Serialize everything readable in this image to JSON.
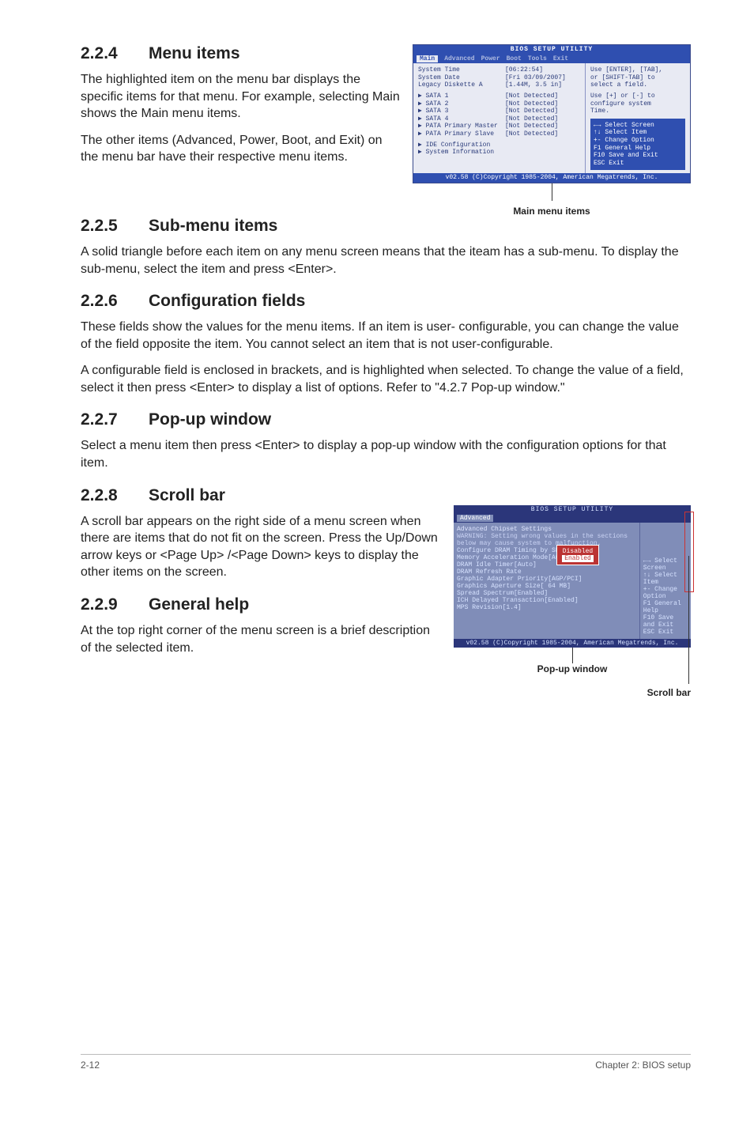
{
  "sections": {
    "s224": {
      "num": "2.2.4",
      "title": "Menu items"
    },
    "s225": {
      "num": "2.2.5",
      "title": "Sub-menu items"
    },
    "s226": {
      "num": "2.2.6",
      "title": "Configuration fields"
    },
    "s227": {
      "num": "2.2.7",
      "title": "Pop-up window"
    },
    "s228": {
      "num": "2.2.8",
      "title": "Scroll bar"
    },
    "s229": {
      "num": "2.2.9",
      "title": "General help"
    }
  },
  "para": {
    "p224a": "The highlighted item on the menu bar displays the specific items for that menu. For example, selecting Main shows the Main menu items.",
    "p224b": "The other items (Advanced, Power, Boot, and Exit) on the menu bar have their respective menu items.",
    "p225": "A solid triangle before each item on any menu screen means that the iteam has a sub-menu. To display the sub-menu, select the item and press <Enter>.",
    "p226a": "These fields show the values for the menu items. If an item is user- configurable, you can change the value of the field opposite the item. You cannot select an item that is not user-configurable.",
    "p226b": "A configurable field is enclosed in brackets, and is highlighted when selected. To change the value of a field, select it then press <Enter> to display a list of options. Refer to \"4.2.7 Pop-up window.\"",
    "p227": "Select a menu item then press <Enter> to display a pop-up window with the configuration options for that item.",
    "p228": "A scroll bar appears on the right side of a menu screen when there are items that do not fit on the screen. Press the Up/Down arrow keys or <Page Up> /<Page Down> keys to display the other items on the screen.",
    "p229": "At the top right corner of the menu screen is a brief description of the selected item."
  },
  "fig1": {
    "caption": "Main menu items",
    "titlebar": "BIOS SETUP UTILITY",
    "tabs": {
      "main": "Main",
      "advanced": "Advanced",
      "power": "Power",
      "boot": "Boot",
      "tools": "Tools",
      "exit": "Exit"
    },
    "rows": {
      "time": {
        "k": "System Time",
        "v": "[06:22:54]"
      },
      "date": {
        "k": "System Date",
        "v": "[Fri 03/09/2007]"
      },
      "floppy": {
        "k": "Legacy Diskette A",
        "v": "[1.44M, 3.5 in]"
      },
      "sata1": {
        "k": "SATA 1",
        "v": "[Not Detected]"
      },
      "sata2": {
        "k": "SATA 2",
        "v": "[Not Detected]"
      },
      "sata3": {
        "k": "SATA 3",
        "v": "[Not Detected]"
      },
      "sata4": {
        "k": "SATA 4",
        "v": "[Not Detected]"
      },
      "patam": {
        "k": "PATA Primary Master",
        "v": "[Not Detected]"
      },
      "patas": {
        "k": "PATA Primary Slave",
        "v": "[Not Detected]"
      },
      "ide": {
        "k": "IDE Configuration",
        "v": ""
      },
      "sysinfo": {
        "k": "System Information",
        "v": ""
      }
    },
    "help": {
      "l1": "Use [ENTER], [TAB],",
      "l2": "or [SHIFT-TAB] to",
      "l3": "select a field.",
      "l4": "Use [+] or [-] to",
      "l5": "configure system",
      "l6": "Time.",
      "k1": "←→    Select Screen",
      "k2": "↑↓    Select Item",
      "k3": "+-    Change Option",
      "k4": "F1    General Help",
      "k5": "F10   Save and Exit",
      "k6": "ESC   Exit"
    },
    "foot": "v02.58 (C)Copyright 1985-2004, American Megatrends, Inc."
  },
  "fig2": {
    "caption_popup": "Pop-up window",
    "caption_scroll": "Scroll bar",
    "titlebar": "BIOS SETUP UTILITY",
    "tab": "Advanced",
    "header": "Advanced Chipset Settings",
    "warn": "WARNING: Setting wrong values in the sections below may cause system to malfunction.",
    "rows": {
      "r1": {
        "k": "Configure DRAM Timing by SPD",
        "v": "[Enabled]"
      },
      "r2": {
        "k": "Memory Acceleration Mode",
        "v": "[Auto]"
      },
      "r3": {
        "k": "DRAM Idle Timer",
        "v": "[Auto]"
      },
      "r4": {
        "k": "DRAM Refresh Rate",
        "v": ""
      },
      "r5": {
        "k": "Graphic Adapter Priority",
        "v": "[AGP/PCI]"
      },
      "r6": {
        "k": "Graphics Aperture Size",
        "v": "[ 64 MB]"
      },
      "r7": {
        "k": "Spread Spectrum",
        "v": "[Enabled]"
      },
      "r8": {
        "k": "ICH Delayed Transaction",
        "v": "[Enabled]"
      },
      "r9": {
        "k": "MPS Revision",
        "v": "[1.4]"
      }
    },
    "popup": {
      "opt1": "Disabled",
      "opt2": "Enabled"
    },
    "help": {
      "k1": "←→   Select Screen",
      "k2": "↑↓   Select Item",
      "k3": "+-   Change Option",
      "k4": "F1   General Help",
      "k5": "F10  Save and Exit",
      "k6": "ESC  Exit"
    },
    "foot": "v02.58 (C)Copyright 1985-2004, American Megatrends, Inc."
  },
  "footer": {
    "left": "2-12",
    "right": "Chapter 2: BIOS setup"
  }
}
